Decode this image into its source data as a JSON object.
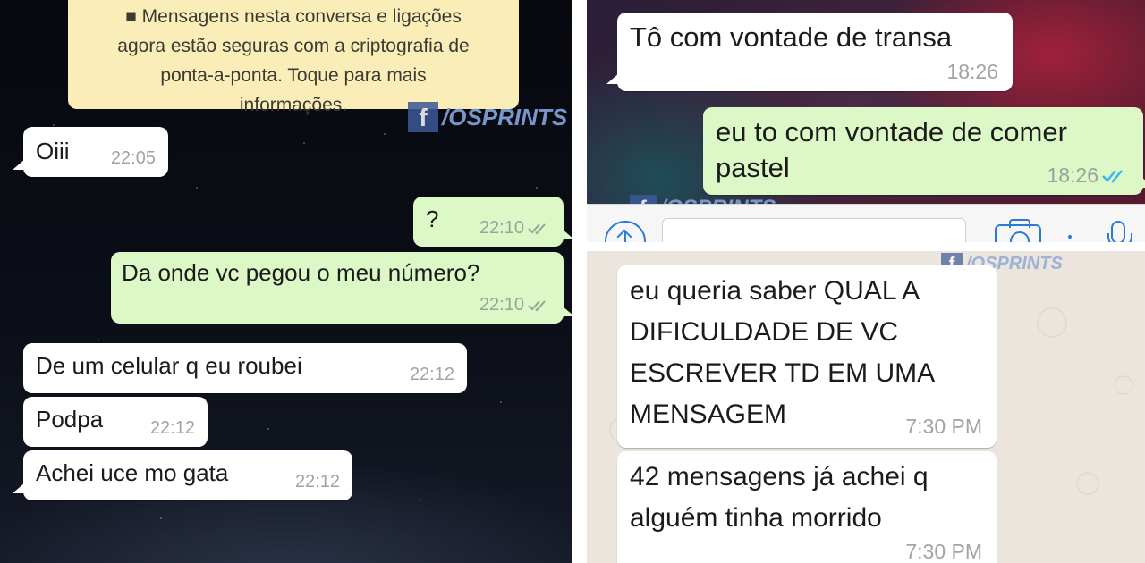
{
  "left_chat": {
    "encryption_notice": {
      "lines": [
        "■ Mensagens nesta conversa e ligações",
        "agora estão seguras com a criptografia de",
        "ponta-a-ponta. Toque para mais",
        "informações."
      ]
    },
    "watermark": {
      "fb": "f",
      "text": "/OSPRINTS"
    },
    "messages": [
      {
        "direction": "incoming",
        "text": "Oiii",
        "time": "22:05"
      },
      {
        "direction": "outgoing",
        "text": "?",
        "time": "22:10"
      },
      {
        "direction": "outgoing",
        "text": "Da onde vc pegou o meu número?",
        "time": "22:10"
      },
      {
        "direction": "incoming",
        "text": "De um celular q eu roubei",
        "time": "22:12"
      },
      {
        "direction": "incoming",
        "text": "Podpa",
        "time": "22:12"
      },
      {
        "direction": "incoming",
        "text": "Achei uce mo gata",
        "time": "22:12"
      }
    ]
  },
  "top_right_chat": {
    "watermark": {
      "fb": "f",
      "text": "/OSPRINTS"
    },
    "messages": [
      {
        "direction": "incoming",
        "text": "Tô com vontade de transa",
        "time": "18:26"
      },
      {
        "direction": "outgoing",
        "lines": [
          "eu to com vontade de comer",
          "pastel"
        ],
        "time": "18:26"
      }
    ],
    "input_bar": {
      "icons": [
        "upload-icon",
        "camera-icon",
        "mic-icon"
      ]
    }
  },
  "bottom_right_chat": {
    "watermark": {
      "fb": "f",
      "text": "/OSPRINTS"
    },
    "messages": [
      {
        "direction": "incoming",
        "lines": [
          "eu queria saber QUAL A",
          "DIFICULDADE DE VC",
          "ESCREVER TD EM UMA",
          "MENSAGEM"
        ],
        "time": "7:30 PM"
      },
      {
        "direction": "incoming",
        "lines": [
          "42 mensagens já achei q",
          "alguém tinha morrido"
        ],
        "time": "7:30 PM"
      }
    ]
  },
  "colors": {
    "incoming_bubble": "#ffffff",
    "outgoing_bubble": "#dcf8c6",
    "encryption_notice": "#fbedb7",
    "read_ticks_blue": "#34b7f1",
    "delivered_ticks_gray": "#9aa39a",
    "facebook_blue": "#3b5998"
  }
}
